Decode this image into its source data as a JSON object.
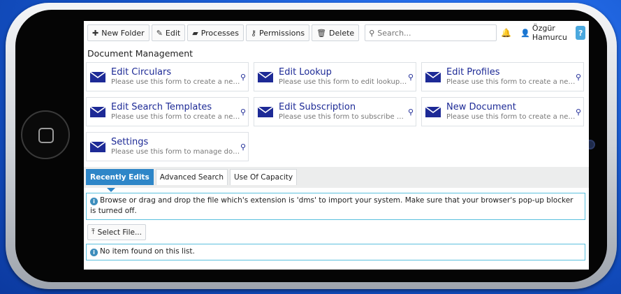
{
  "toolbar": {
    "new_folder": "New Folder",
    "edit": "Edit",
    "processes": "Processes",
    "permissions": "Permissions",
    "delete": "Delete",
    "search_placeholder": "Search...",
    "user_name": "Özgür Hamurcu",
    "help": "?"
  },
  "section": {
    "title": "Document Management"
  },
  "cards": [
    {
      "title": "Edit Circulars",
      "desc": "Please use this form to create a new c..."
    },
    {
      "title": "Edit Lookup",
      "desc": "Please use this form to edit lookup list..."
    },
    {
      "title": "Edit Profiles",
      "desc": "Please use this form to create a new p..."
    },
    {
      "title": "Edit Search Templates",
      "desc": "Please use this form to create a new s..."
    },
    {
      "title": "Edit Subscription",
      "desc": "Please use this form to subscribe doc..."
    },
    {
      "title": "New Document",
      "desc": "Please use this form to create a new d..."
    },
    {
      "title": "Settings",
      "desc": "Please use this form to manage docu..."
    }
  ],
  "tabs": [
    {
      "label": "Recently Edits"
    },
    {
      "label": "Advanced Search"
    },
    {
      "label": "Use Of Capacity"
    }
  ],
  "content": {
    "info_text": "Browse or drag and drop the file which's extension is 'dms' to import your system. Make sure that your browser's pop-up blocker is turned off.",
    "select_file": "Select File...",
    "empty_text": "No item found on this list."
  },
  "colors": {
    "accent": "#2e86c8",
    "card_title": "#1d2a96",
    "info_border": "#5bc0de",
    "help_button": "#4aa8de",
    "background": "#1a5cd6"
  }
}
